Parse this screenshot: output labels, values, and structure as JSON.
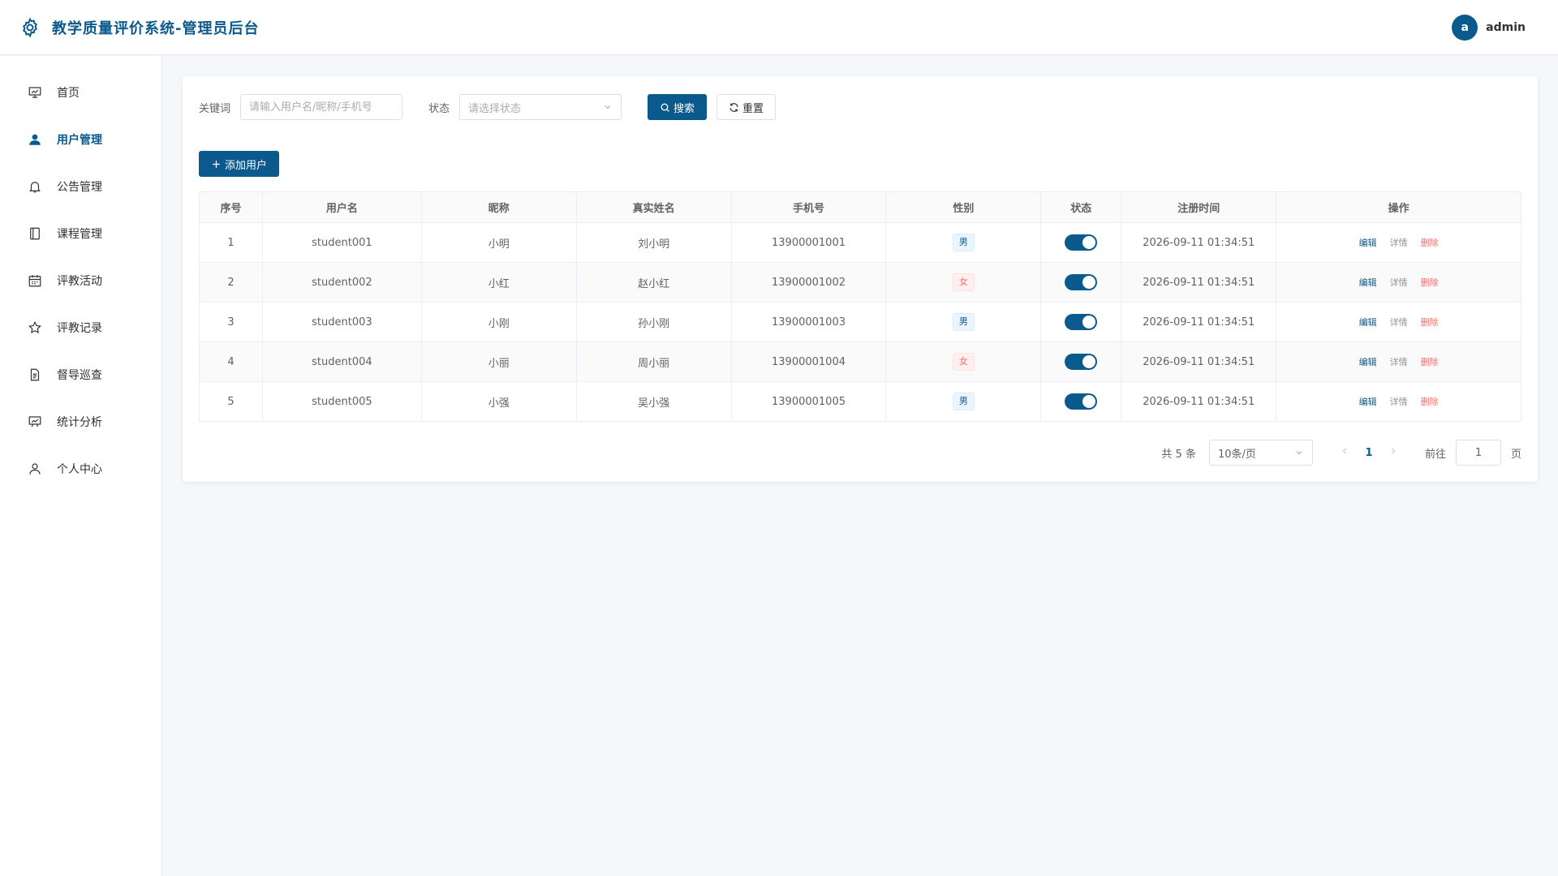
{
  "header": {
    "title": "教学质量评价系统-管理员后台",
    "avatar_letter": "a",
    "username": "admin"
  },
  "sidebar": {
    "items": [
      {
        "label": "首页",
        "icon": "presentation-icon"
      },
      {
        "label": "用户管理",
        "icon": "user-icon"
      },
      {
        "label": "公告管理",
        "icon": "bell-icon"
      },
      {
        "label": "课程管理",
        "icon": "book-icon"
      },
      {
        "label": "评教活动",
        "icon": "calendar-icon"
      },
      {
        "label": "评教记录",
        "icon": "star-icon"
      },
      {
        "label": "督导巡查",
        "icon": "document-icon"
      },
      {
        "label": "统计分析",
        "icon": "chart-board-icon"
      },
      {
        "label": "个人中心",
        "icon": "person-icon"
      }
    ],
    "active_index": 1
  },
  "filters": {
    "keyword_label": "关键词",
    "keyword_placeholder": "请输入用户名/昵称/手机号",
    "status_label": "状态",
    "status_placeholder": "请选择状态",
    "search_label": "搜索",
    "reset_label": "重置"
  },
  "actions": {
    "add_label": "添加用户"
  },
  "table": {
    "headers": [
      "序号",
      "用户名",
      "昵称",
      "真实姓名",
      "手机号",
      "性别",
      "状态",
      "注册时间",
      "操作"
    ],
    "rows": [
      {
        "no": "1",
        "username": "student001",
        "nickname": "小明",
        "realname": "刘小明",
        "phone": "13900001001",
        "gender": "男",
        "enabled": true,
        "created": "2026-09-11 01:34:51"
      },
      {
        "no": "2",
        "username": "student002",
        "nickname": "小红",
        "realname": "赵小红",
        "phone": "13900001002",
        "gender": "女",
        "enabled": true,
        "created": "2026-09-11 01:34:51"
      },
      {
        "no": "3",
        "username": "student003",
        "nickname": "小刚",
        "realname": "孙小刚",
        "phone": "13900001003",
        "gender": "男",
        "enabled": true,
        "created": "2026-09-11 01:34:51"
      },
      {
        "no": "4",
        "username": "student004",
        "nickname": "小丽",
        "realname": "周小丽",
        "phone": "13900001004",
        "gender": "女",
        "enabled": true,
        "created": "2026-09-11 01:34:51"
      },
      {
        "no": "5",
        "username": "student005",
        "nickname": "小强",
        "realname": "吴小强",
        "phone": "13900001005",
        "gender": "男",
        "enabled": true,
        "created": "2026-09-11 01:34:51"
      }
    ],
    "op_edit": "编辑",
    "op_detail": "详情",
    "op_delete": "删除"
  },
  "pagination": {
    "total_text": "共 5 条",
    "page_size": "10条/页",
    "current_page": "1",
    "goto_label": "前往",
    "goto_value": "1",
    "page_suffix": "页"
  },
  "colors": {
    "primary": "#0b5a8e",
    "danger": "#f56c6c"
  }
}
